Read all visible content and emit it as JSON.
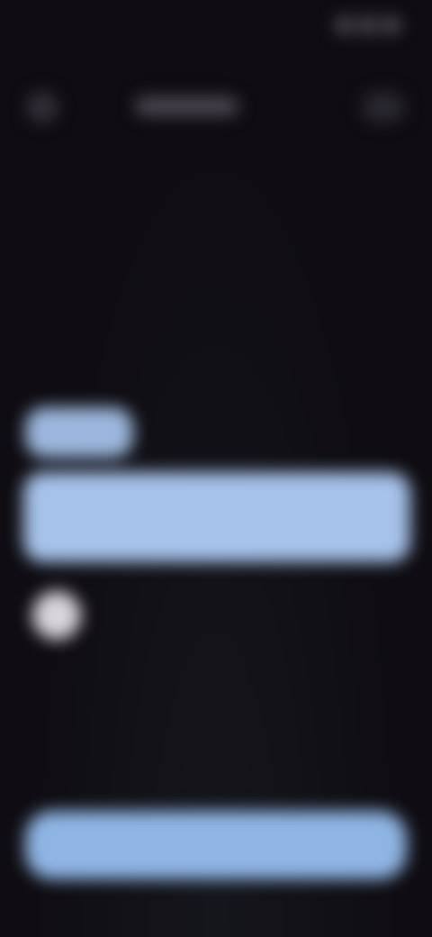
{
  "status_bar": {
    "time": "",
    "icons": [
      "signal-icon",
      "wifi-icon",
      "battery-icon"
    ]
  },
  "header": {
    "back_icon": "back-arrow-icon",
    "title": "",
    "menu_icon": "more-options-icon"
  },
  "content": {
    "chip_label": "",
    "card_text": "",
    "avatar_icon": "avatar"
  },
  "footer": {
    "primary_button_label": ""
  },
  "colors": {
    "background": "#0f0d12",
    "accent_light_blue": "#a6c2ea",
    "button_blue": "#8fb5e4",
    "avatar_light": "#d8d6dc"
  }
}
